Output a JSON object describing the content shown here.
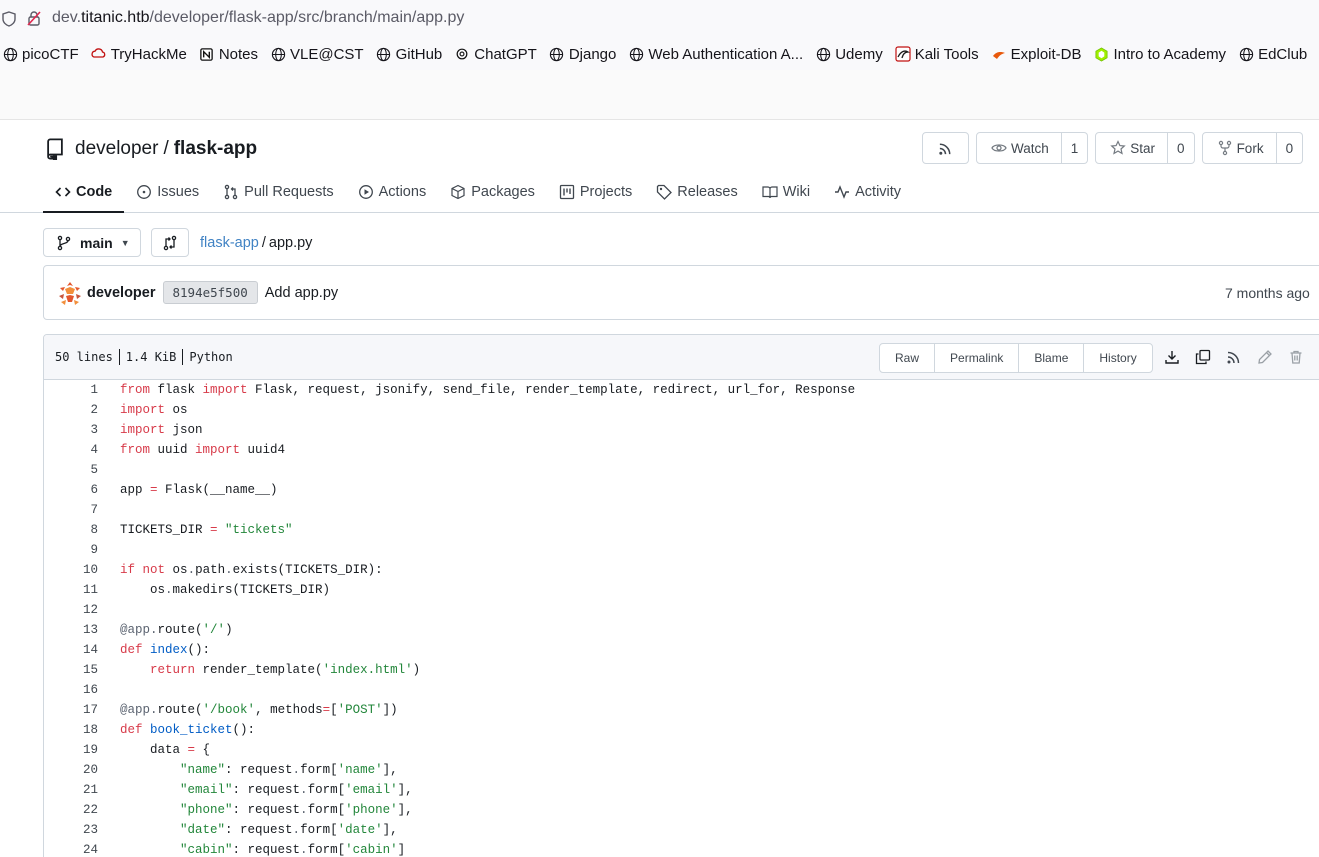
{
  "browser": {
    "url_prefix": "dev.",
    "url_host": "titanic.htb",
    "url_path": "/developer/flask-app/src/branch/main/app.py",
    "bookmarks": [
      {
        "label": "picoCTF",
        "icon": "globe-icon"
      },
      {
        "label": "TryHackMe",
        "icon": "tryhackme-icon"
      },
      {
        "label": "Notes",
        "icon": "notion-icon"
      },
      {
        "label": "VLE@CST",
        "icon": "globe-icon"
      },
      {
        "label": "GitHub",
        "icon": "globe-icon"
      },
      {
        "label": "ChatGPT",
        "icon": "chatgpt-icon"
      },
      {
        "label": "Django",
        "icon": "globe-icon"
      },
      {
        "label": "Web Authentication A...",
        "icon": "globe-icon"
      },
      {
        "label": "Udemy",
        "icon": "globe-icon"
      },
      {
        "label": "Kali Tools",
        "icon": "kali-icon"
      },
      {
        "label": "Exploit-DB",
        "icon": "exploitdb-icon"
      },
      {
        "label": "Intro to Academy",
        "icon": "academy-icon"
      },
      {
        "label": "EdClub",
        "icon": "globe-icon"
      }
    ]
  },
  "repo": {
    "owner": "developer",
    "separator": "/",
    "name": "flask-app",
    "watch_label": "Watch",
    "watch_count": "1",
    "star_label": "Star",
    "star_count": "0",
    "fork_label": "Fork",
    "fork_count": "0"
  },
  "tabs": [
    {
      "label": "Code",
      "icon": "code-icon",
      "active": true
    },
    {
      "label": "Issues",
      "icon": "issue-icon"
    },
    {
      "label": "Pull Requests",
      "icon": "pull-request-icon"
    },
    {
      "label": "Actions",
      "icon": "play-icon"
    },
    {
      "label": "Packages",
      "icon": "package-icon"
    },
    {
      "label": "Projects",
      "icon": "project-icon"
    },
    {
      "label": "Releases",
      "icon": "tag-icon"
    },
    {
      "label": "Wiki",
      "icon": "book-icon"
    },
    {
      "label": "Activity",
      "icon": "pulse-icon"
    }
  ],
  "branch": {
    "name": "main",
    "crumb_repo": "flask-app",
    "crumb_sep": "/",
    "crumb_file": "app.py"
  },
  "commit": {
    "author": "developer",
    "sha": "8194e5f500",
    "message": "Add app.py",
    "time": "7 months ago"
  },
  "file": {
    "lines": "50 lines",
    "size": "1.4 KiB",
    "language": "Python",
    "buttons": [
      "Raw",
      "Permalink",
      "Blame",
      "History"
    ]
  },
  "code_lines": [
    "from flask import Flask, request, jsonify, send_file, render_template, redirect, url_for, Response",
    "import os",
    "import json",
    "from uuid import uuid4",
    "",
    "app = Flask(__name__)",
    "",
    "TICKETS_DIR = \"tickets\"",
    "",
    "if not os.path.exists(TICKETS_DIR):",
    "    os.makedirs(TICKETS_DIR)",
    "",
    "@app.route('/')",
    "def index():",
    "    return render_template('index.html')",
    "",
    "@app.route('/book', methods=['POST'])",
    "def book_ticket():",
    "    data = {",
    "        \"name\": request.form['name'],",
    "        \"email\": request.form['email'],",
    "        \"phone\": request.form['phone'],",
    "        \"date\": request.form['date'],",
    "        \"cabin\": request.form['cabin']"
  ]
}
